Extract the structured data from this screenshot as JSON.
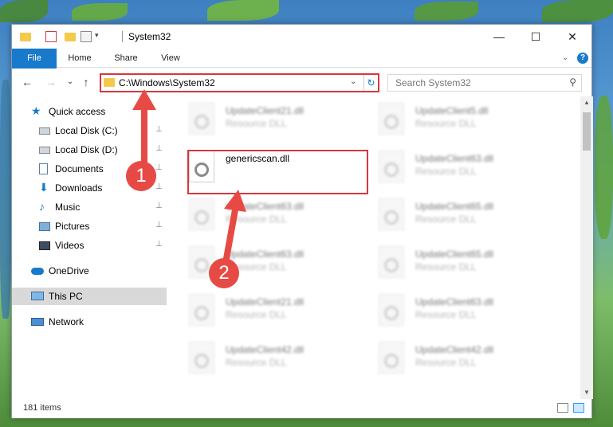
{
  "window": {
    "title": "System32",
    "minimize_glyph": "—",
    "maximize_glyph": "☐",
    "close_glyph": "✕"
  },
  "ribbon": {
    "tabs": [
      {
        "label": "File"
      },
      {
        "label": "Home"
      },
      {
        "label": "Share"
      },
      {
        "label": "View"
      }
    ],
    "expand_glyph": "⌄",
    "help_glyph": "?"
  },
  "navigation": {
    "back_glyph": "←",
    "forward_glyph": "→",
    "recent_glyph": "⌄",
    "up_glyph": "↑",
    "address": "C:\\Windows\\System32",
    "dropdown_glyph": "⌄",
    "refresh_glyph": "↻",
    "search_placeholder": "Search System32",
    "search_glyph": "⚲"
  },
  "nav_pane": {
    "items": [
      {
        "label": "Quick access",
        "icon": "star-icon",
        "pinned": false
      },
      {
        "label": "Local Disk (C:)",
        "icon": "drive-icon",
        "pinned": true
      },
      {
        "label": "Local Disk (D:)",
        "icon": "drive-icon",
        "pinned": true
      },
      {
        "label": "Documents",
        "icon": "documents-icon",
        "pinned": true
      },
      {
        "label": "Downloads",
        "icon": "download-icon",
        "pinned": true
      },
      {
        "label": "Music",
        "icon": "music-icon",
        "pinned": true
      },
      {
        "label": "Pictures",
        "icon": "pictures-icon",
        "pinned": true
      },
      {
        "label": "Videos",
        "icon": "videos-icon",
        "pinned": true
      },
      {
        "label": "OneDrive",
        "icon": "cloud-icon",
        "pinned": false
      },
      {
        "label": "This PC",
        "icon": "computer-icon",
        "pinned": false
      },
      {
        "label": "Network",
        "icon": "network-icon",
        "pinned": false
      }
    ],
    "pin_glyph": "📌"
  },
  "files": [
    {
      "name": "UpdateClient21.dll",
      "type": "Resource DLL",
      "blurred": true
    },
    {
      "name": "UpdateClient5.dll",
      "type": "Resource DLL",
      "blurred": true
    },
    {
      "name": "genericscan.dll",
      "type": "",
      "blurred": false
    },
    {
      "name": "UpdateClient63.dll",
      "type": "Resource DLL",
      "blurred": true
    },
    {
      "name": "UpdateClient63.dll",
      "type": "Resource DLL",
      "blurred": true
    },
    {
      "name": "UpdateClient65.dll",
      "type": "Resource DLL",
      "blurred": true
    },
    {
      "name": "UpdateClient63.dll",
      "type": "Resource DLL",
      "blurred": true
    },
    {
      "name": "UpdateClient65.dll",
      "type": "Resource DLL",
      "blurred": true
    },
    {
      "name": "UpdateClient21.dll",
      "type": "Resource DLL",
      "blurred": true
    },
    {
      "name": "UpdateClient63.dll",
      "type": "Resource DLL",
      "blurred": true
    },
    {
      "name": "UpdateClient42.dll",
      "type": "Resource DLL",
      "blurred": true
    },
    {
      "name": "UpdateClient42.dll",
      "type": "Resource DLL",
      "blurred": true
    }
  ],
  "status": {
    "item_count": "181 items"
  },
  "callouts": [
    "1",
    "2"
  ],
  "colors": {
    "accent": "#1979ca",
    "highlight_red": "#d9363e",
    "callout_red": "#e74a44",
    "selected_bg": "#cce8ff"
  }
}
